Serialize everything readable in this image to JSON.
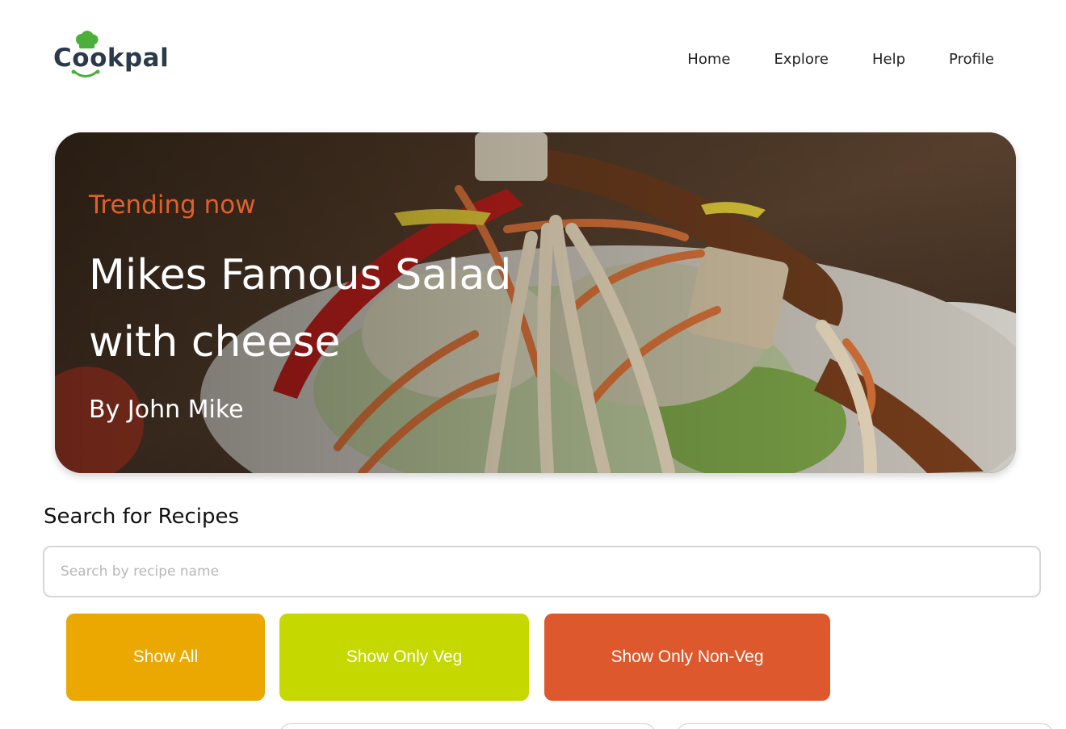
{
  "brand": {
    "name_prefix": "C",
    "name_oo": "oo",
    "name_suffix": "kpal",
    "logo_icon": "chef-hat-icon",
    "hat_color": "#4caf3a",
    "text_color": "#2b3a4a"
  },
  "nav": {
    "items": [
      {
        "label": "Home"
      },
      {
        "label": "Explore"
      },
      {
        "label": "Help"
      },
      {
        "label": "Profile"
      }
    ]
  },
  "hero": {
    "kicker": "Trending now",
    "title": "Mikes Famous Salad with cheese",
    "author": "By John Mike",
    "kicker_color": "#e0602c"
  },
  "search": {
    "heading": "Search for Recipes",
    "placeholder": "Search by recipe name",
    "value": ""
  },
  "filters": {
    "all": {
      "label": "Show All",
      "color": "#eaa800"
    },
    "veg": {
      "label": "Show Only Veg",
      "color": "#c5d800"
    },
    "nonveg": {
      "label": "Show Only Non-Veg",
      "color": "#dd582c"
    }
  }
}
